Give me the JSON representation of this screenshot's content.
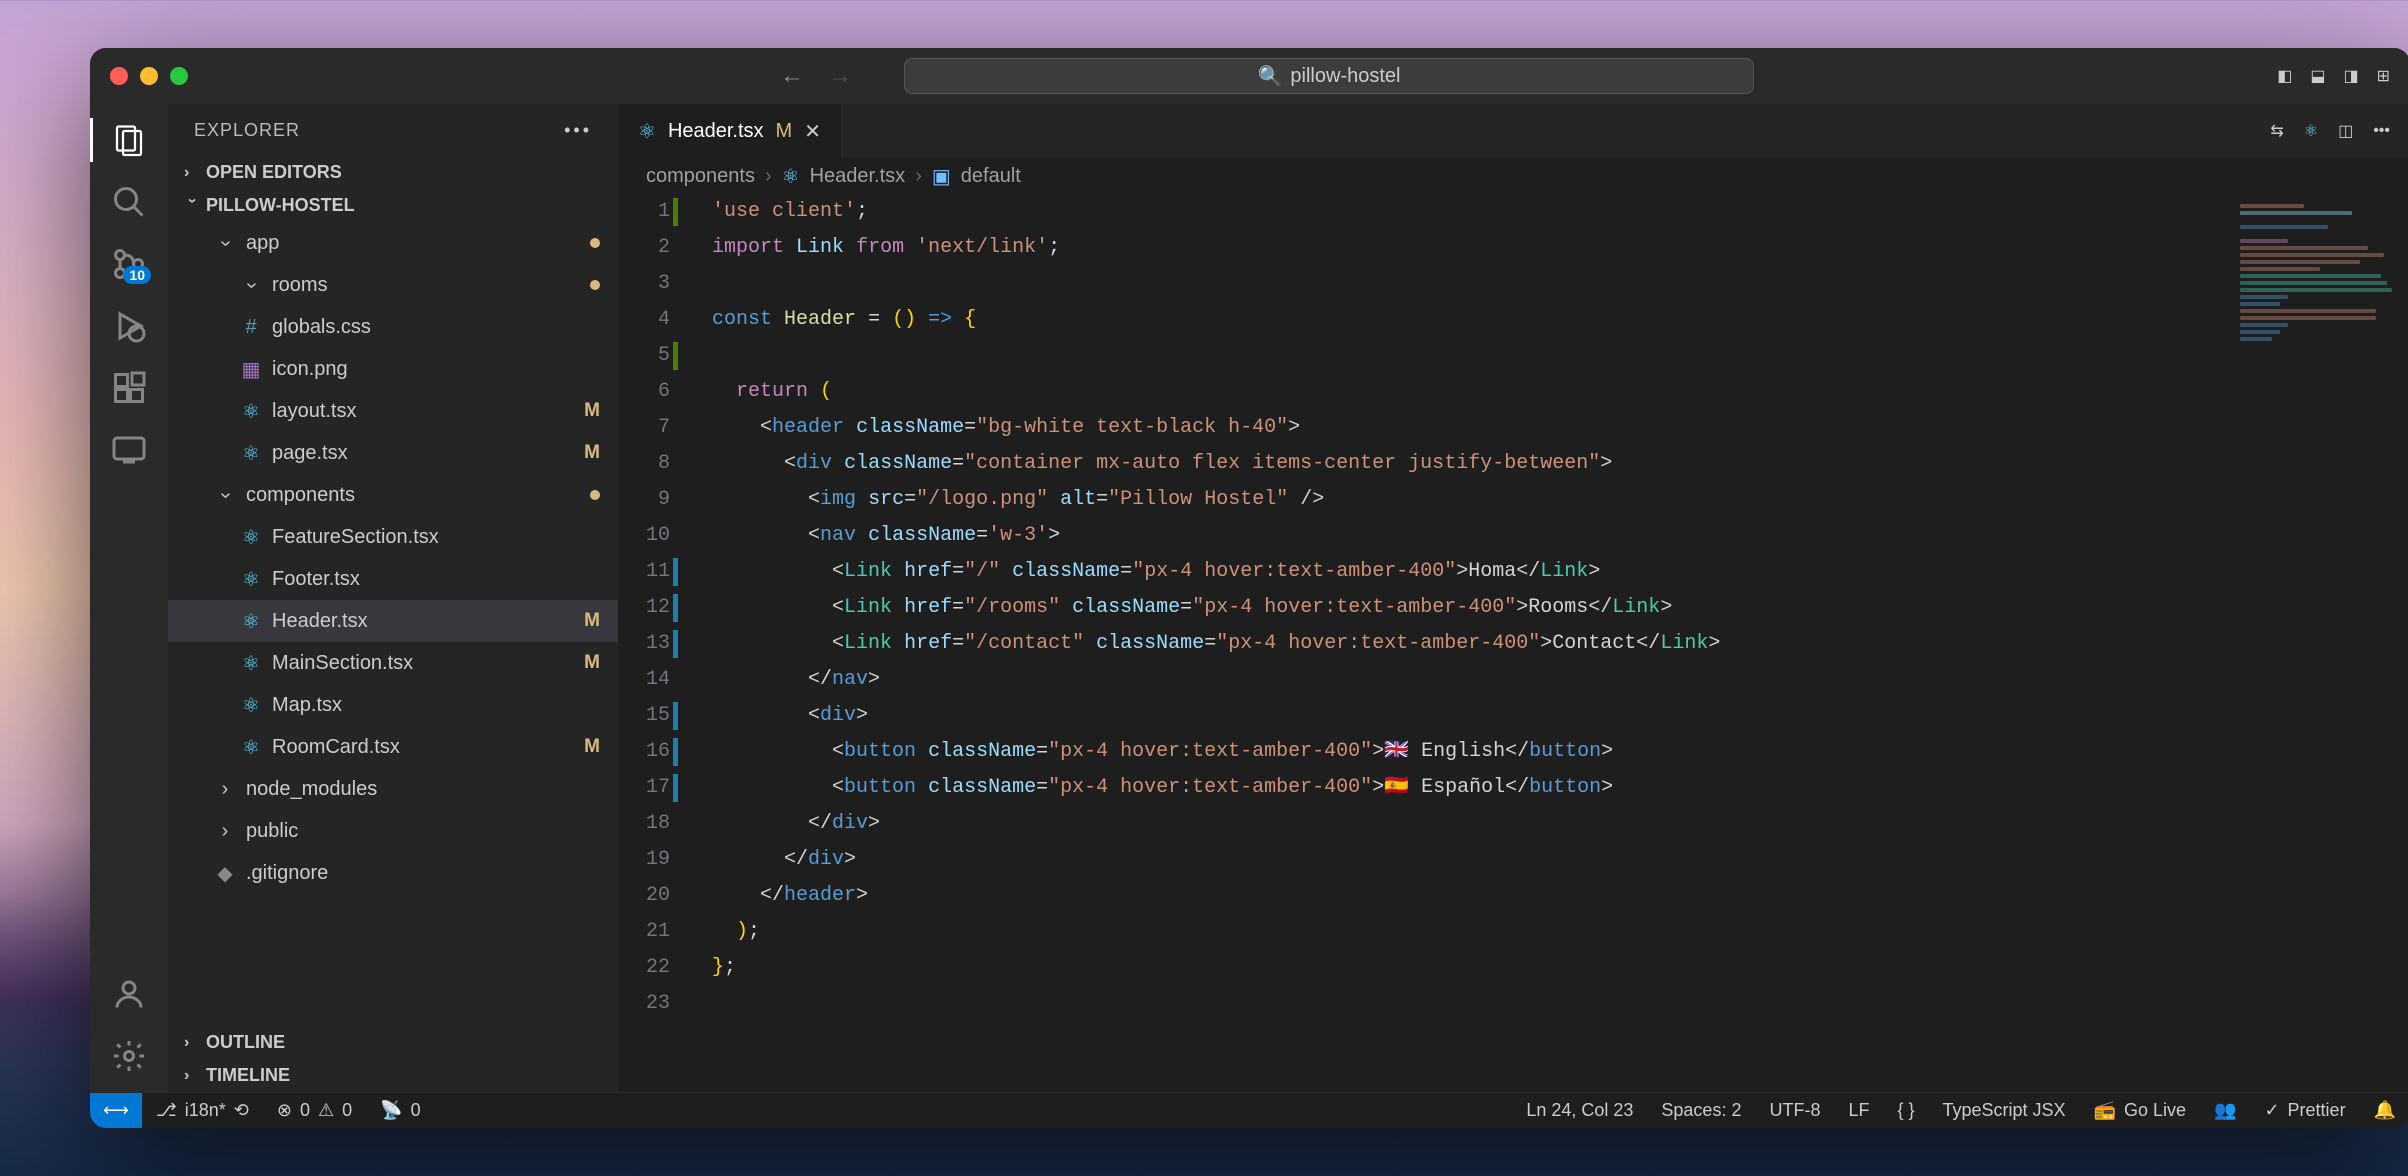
{
  "search_placeholder": "pillow-hostel",
  "explorer_title": "EXPLORER",
  "sections": {
    "open_editors": "OPEN EDITORS",
    "project": "PILLOW-HOSTEL",
    "outline": "OUTLINE",
    "timeline": "TIMELINE"
  },
  "scm_badge": "10",
  "tree": [
    {
      "label": "app",
      "type": "folder",
      "depth": 1,
      "open": true,
      "mod": "dot"
    },
    {
      "label": "rooms",
      "type": "folder",
      "depth": 2,
      "open": true,
      "mod": "dot"
    },
    {
      "label": "globals.css",
      "type": "css",
      "depth": 2
    },
    {
      "label": "icon.png",
      "type": "img",
      "depth": 2
    },
    {
      "label": "layout.tsx",
      "type": "react",
      "depth": 2,
      "mod": "M"
    },
    {
      "label": "page.tsx",
      "type": "react",
      "depth": 2,
      "mod": "M"
    },
    {
      "label": "components",
      "type": "folder",
      "depth": 1,
      "open": true,
      "mod": "dot"
    },
    {
      "label": "FeatureSection.tsx",
      "type": "react",
      "depth": 2
    },
    {
      "label": "Footer.tsx",
      "type": "react",
      "depth": 2
    },
    {
      "label": "Header.tsx",
      "type": "react",
      "depth": 2,
      "mod": "M",
      "selected": true
    },
    {
      "label": "MainSection.tsx",
      "type": "react",
      "depth": 2,
      "mod": "M"
    },
    {
      "label": "Map.tsx",
      "type": "react",
      "depth": 2
    },
    {
      "label": "RoomCard.tsx",
      "type": "react",
      "depth": 2,
      "mod": "M"
    },
    {
      "label": "node_modules",
      "type": "folder",
      "depth": 1,
      "open": false
    },
    {
      "label": "public",
      "type": "folder",
      "depth": 1,
      "open": false
    },
    {
      "label": ".gitignore",
      "type": "file",
      "depth": 1
    }
  ],
  "tab": {
    "file": "Header.tsx",
    "status": "M"
  },
  "breadcrumb": {
    "a": "components",
    "b": "Header.tsx",
    "c": "default"
  },
  "code_lines": [
    {
      "n": 1,
      "mod": "green",
      "html": "<span class='tok-string'>'use client'</span>;"
    },
    {
      "n": 2,
      "html": "<span class='tok-keyword'>import</span> <span class='tok-var'>Link</span> <span class='tok-keyword'>from</span> <span class='tok-string'>'next/link'</span>;"
    },
    {
      "n": 3,
      "html": ""
    },
    {
      "n": 4,
      "html": "<span class='tok-const'>const</span> <span class='tok-func'>Header</span> <span class='tok-op'>=</span> <span class='tok-brace'>()</span> <span class='tok-const'>=&gt;</span> <span class='tok-brace'>{</span>"
    },
    {
      "n": 5,
      "mod": "green",
      "html": ""
    },
    {
      "n": 6,
      "html": "  <span class='tok-keyword'>return</span> <span class='tok-brace'>(</span>"
    },
    {
      "n": 7,
      "html": "    <span class='tok-op'>&lt;</span><span class='tok-tag'>header</span> <span class='tok-attr'>className</span>=<span class='tok-string'>\"bg-white text-black h-40\"</span><span class='tok-op'>&gt;</span>"
    },
    {
      "n": 8,
      "html": "      <span class='tok-op'>&lt;</span><span class='tok-tag'>div</span> <span class='tok-attr'>className</span>=<span class='tok-string'>\"container mx-auto flex items-center justify-between\"</span><span class='tok-op'>&gt;</span>"
    },
    {
      "n": 9,
      "html": "        <span class='tok-op'>&lt;</span><span class='tok-tag'>img</span> <span class='tok-attr'>src</span>=<span class='tok-string'>\"/logo.png\"</span> <span class='tok-attr'>alt</span>=<span class='tok-string'>\"Pillow Hostel\"</span> <span class='tok-op'>/&gt;</span>"
    },
    {
      "n": 10,
      "html": "        <span class='tok-op'>&lt;</span><span class='tok-tag'>nav</span> <span class='tok-attr'>className</span>=<span class='tok-string'>'w-3'</span><span class='tok-op'>&gt;</span>"
    },
    {
      "n": 11,
      "mod": "blue",
      "html": "          <span class='tok-op'>&lt;</span><span class='tok-comp'>Link</span> <span class='tok-attr'>href</span>=<span class='tok-string'>\"/\"</span> <span class='tok-attr'>className</span>=<span class='tok-string'>\"px-4 hover:text-amber-400\"</span><span class='tok-op'>&gt;</span>Homa<span class='tok-op'>&lt;/</span><span class='tok-comp'>Link</span><span class='tok-op'>&gt;</span>"
    },
    {
      "n": 12,
      "mod": "blue",
      "html": "          <span class='tok-op'>&lt;</span><span class='tok-comp'>Link</span> <span class='tok-attr'>href</span>=<span class='tok-string'>\"/rooms\"</span> <span class='tok-attr'>className</span>=<span class='tok-string'>\"px-4 hover:text-amber-400\"</span><span class='tok-op'>&gt;</span>Rooms<span class='tok-op'>&lt;/</span><span class='tok-comp'>Link</span><span class='tok-op'>&gt;</span>"
    },
    {
      "n": 13,
      "mod": "blue",
      "html": "          <span class='tok-op'>&lt;</span><span class='tok-comp'>Link</span> <span class='tok-attr'>href</span>=<span class='tok-string'>\"/contact\"</span> <span class='tok-attr'>className</span>=<span class='tok-string'>\"px-4 hover:text-amber-400\"</span><span class='tok-op'>&gt;</span>Contact<span class='tok-op'>&lt;/</span><span class='tok-comp'>Link</span><span class='tok-op'>&gt;</span>"
    },
    {
      "n": 14,
      "html": "        <span class='tok-op'>&lt;/</span><span class='tok-tag'>nav</span><span class='tok-op'>&gt;</span>"
    },
    {
      "n": 15,
      "mod": "blue",
      "html": "        <span class='tok-op'>&lt;</span><span class='tok-tag'>div</span><span class='tok-op'>&gt;</span>"
    },
    {
      "n": 16,
      "mod": "blue",
      "html": "          <span class='tok-op'>&lt;</span><span class='tok-tag'>button</span> <span class='tok-attr'>className</span>=<span class='tok-string'>\"px-4 hover:text-amber-400\"</span><span class='tok-op'>&gt;</span>🇬🇧 English<span class='tok-op'>&lt;/</span><span class='tok-tag'>button</span><span class='tok-op'>&gt;</span>"
    },
    {
      "n": 17,
      "mod": "blue",
      "html": "          <span class='tok-op'>&lt;</span><span class='tok-tag'>button</span> <span class='tok-attr'>className</span>=<span class='tok-string'>\"px-4 hover:text-amber-400\"</span><span class='tok-op'>&gt;</span>🇪🇸 Español<span class='tok-op'>&lt;/</span><span class='tok-tag'>button</span><span class='tok-op'>&gt;</span>"
    },
    {
      "n": 18,
      "html": "        <span class='tok-op'>&lt;/</span><span class='tok-tag'>div</span><span class='tok-op'>&gt;</span>"
    },
    {
      "n": 19,
      "html": "      <span class='tok-op'>&lt;/</span><span class='tok-tag'>div</span><span class='tok-op'>&gt;</span>"
    },
    {
      "n": 20,
      "html": "    <span class='tok-op'>&lt;/</span><span class='tok-tag'>header</span><span class='tok-op'>&gt;</span>"
    },
    {
      "n": 21,
      "html": "  <span class='tok-brace'>)</span>;"
    },
    {
      "n": 22,
      "html": "<span class='tok-brace'>}</span>;"
    },
    {
      "n": 23,
      "html": ""
    }
  ],
  "status": {
    "branch": "i18n*",
    "errors": "0",
    "warnings": "0",
    "port": "0",
    "ln_col": "Ln 24, Col 23",
    "spaces": "Spaces: 2",
    "encoding": "UTF-8",
    "eol": "LF",
    "lang": "TypeScript JSX",
    "golive": "Go Live",
    "prettier": "Prettier"
  }
}
